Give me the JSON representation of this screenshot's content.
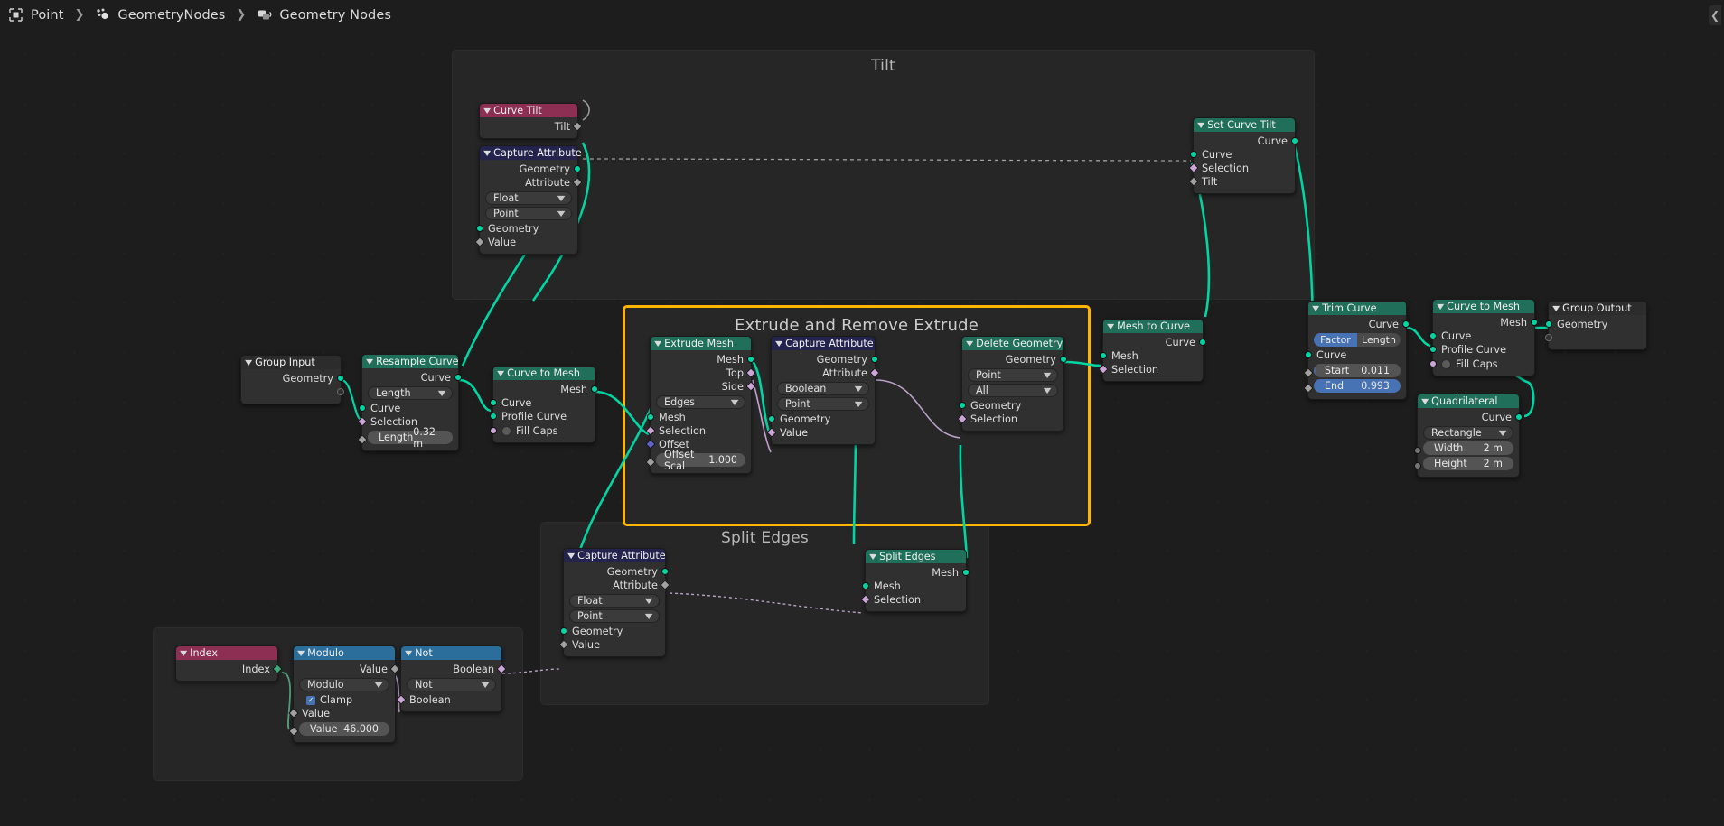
{
  "breadcrumb": {
    "items": [
      {
        "label": "Point",
        "icon": "object-icon"
      },
      {
        "label": "GeometryNodes",
        "icon": "modifier-icon"
      },
      {
        "label": "Geometry Nodes",
        "icon": "geometry-nodes-icon"
      }
    ],
    "collapse_arrow": "❮"
  },
  "frames": [
    {
      "id": "tilt",
      "title": "Tilt",
      "selected": false
    },
    {
      "id": "extrude",
      "title": "Extrude and Remove Extrude",
      "selected": true
    },
    {
      "id": "splitedges",
      "title": "Split Edges",
      "selected": false
    },
    {
      "id": "math",
      "title": "",
      "selected": false
    }
  ],
  "nodes": {
    "curve_tilt": {
      "title": "Curve Tilt",
      "outputs": [
        {
          "label": "Tilt"
        }
      ]
    },
    "capture_attribute_tilt": {
      "title": "Capture Attribute",
      "outputs": [
        {
          "label": "Geometry"
        },
        {
          "label": "Attribute"
        }
      ],
      "dropdowns": [
        {
          "value": "Float"
        },
        {
          "value": "Point"
        }
      ],
      "inputs": [
        {
          "label": "Geometry"
        },
        {
          "label": "Value"
        }
      ]
    },
    "set_curve_tilt": {
      "title": "Set Curve Tilt",
      "outputs": [
        {
          "label": "Curve"
        }
      ],
      "inputs": [
        {
          "label": "Curve"
        },
        {
          "label": "Selection"
        },
        {
          "label": "Tilt"
        }
      ]
    },
    "group_input": {
      "title": "Group Input",
      "outputs": [
        {
          "label": "Geometry"
        },
        {
          "label": ""
        }
      ]
    },
    "resample_curve": {
      "title": "Resample Curve",
      "outputs": [
        {
          "label": "Curve"
        }
      ],
      "dropdowns": [
        {
          "value": "Length"
        }
      ],
      "inputs": [
        {
          "label": "Curve"
        },
        {
          "label": "Selection"
        }
      ],
      "fields": [
        {
          "name": "Length",
          "value": "0.32 m"
        }
      ]
    },
    "curve_to_mesh_left": {
      "title": "Curve to Mesh",
      "outputs": [
        {
          "label": "Mesh"
        }
      ],
      "inputs": [
        {
          "label": "Curve"
        },
        {
          "label": "Profile Curve"
        },
        {
          "label": "Fill Caps"
        }
      ]
    },
    "extrude_mesh": {
      "title": "Extrude Mesh",
      "outputs": [
        {
          "label": "Mesh"
        },
        {
          "label": "Top"
        },
        {
          "label": "Side"
        }
      ],
      "dropdowns": [
        {
          "value": "Edges"
        }
      ],
      "inputs": [
        {
          "label": "Mesh"
        },
        {
          "label": "Selection"
        },
        {
          "label": "Offset"
        }
      ],
      "fields": [
        {
          "name": "Offset Scal",
          "value": "1.000"
        }
      ]
    },
    "capture_attribute_extrude": {
      "title": "Capture Attribute",
      "outputs": [
        {
          "label": "Geometry"
        },
        {
          "label": "Attribute"
        }
      ],
      "dropdowns": [
        {
          "value": "Boolean"
        },
        {
          "value": "Point"
        }
      ],
      "inputs": [
        {
          "label": "Geometry"
        },
        {
          "label": "Value"
        }
      ]
    },
    "delete_geometry": {
      "title": "Delete Geometry",
      "outputs": [
        {
          "label": "Geometry"
        }
      ],
      "dropdowns": [
        {
          "value": "Point"
        },
        {
          "value": "All"
        }
      ],
      "inputs": [
        {
          "label": "Geometry"
        },
        {
          "label": "Selection"
        }
      ]
    },
    "mesh_to_curve": {
      "title": "Mesh to Curve",
      "outputs": [
        {
          "label": "Curve"
        }
      ],
      "inputs": [
        {
          "label": "Mesh"
        },
        {
          "label": "Selection"
        }
      ]
    },
    "trim_curve": {
      "title": "Trim Curve",
      "outputs": [
        {
          "label": "Curve"
        }
      ],
      "toggle": {
        "left": "Factor",
        "right": "Length",
        "active": "Factor"
      },
      "inputs": [
        {
          "label": "Curve"
        }
      ],
      "fields": [
        {
          "name": "Start",
          "value": "0.011"
        },
        {
          "name": "End",
          "value": "0.993"
        }
      ]
    },
    "curve_to_mesh_right": {
      "title": "Curve to Mesh",
      "outputs": [
        {
          "label": "Mesh"
        }
      ],
      "inputs": [
        {
          "label": "Curve"
        },
        {
          "label": "Profile Curve"
        },
        {
          "label": "Fill Caps"
        }
      ]
    },
    "quadrilateral": {
      "title": "Quadrilateral",
      "outputs": [
        {
          "label": "Curve"
        }
      ],
      "dropdowns": [
        {
          "value": "Rectangle"
        }
      ],
      "fields": [
        {
          "name": "Width",
          "value": "2 m"
        },
        {
          "name": "Height",
          "value": "2 m"
        }
      ]
    },
    "group_output": {
      "title": "Group Output",
      "inputs": [
        {
          "label": "Geometry"
        },
        {
          "label": ""
        }
      ]
    },
    "capture_attribute_split": {
      "title": "Capture Attribute",
      "outputs": [
        {
          "label": "Geometry"
        },
        {
          "label": "Attribute"
        }
      ],
      "dropdowns": [
        {
          "value": "Float"
        },
        {
          "value": "Point"
        }
      ],
      "inputs": [
        {
          "label": "Geometry"
        },
        {
          "label": "Value"
        }
      ]
    },
    "split_edges": {
      "title": "Split Edges",
      "outputs": [
        {
          "label": "Mesh"
        }
      ],
      "inputs": [
        {
          "label": "Mesh"
        },
        {
          "label": "Selection"
        }
      ]
    },
    "index": {
      "title": "Index",
      "outputs": [
        {
          "label": "Index"
        }
      ]
    },
    "modulo": {
      "title": "Modulo",
      "outputs": [
        {
          "label": "Value"
        }
      ],
      "dropdowns": [
        {
          "value": "Modulo"
        }
      ],
      "checkbox": {
        "label": "Clamp",
        "checked": true,
        "mark": "✓"
      },
      "inputs": [
        {
          "label": "Value"
        }
      ],
      "fields": [
        {
          "name": "Value",
          "value": "46.000"
        }
      ]
    },
    "not": {
      "title": "Not",
      "outputs": [
        {
          "label": "Boolean"
        }
      ],
      "dropdowns": [
        {
          "value": "Not"
        }
      ],
      "inputs": [
        {
          "label": "Boolean"
        }
      ]
    }
  },
  "colors": {
    "geometry_header": "#1f6f5a",
    "attribute_header": "#23234d",
    "input_header": "#8c2f53",
    "converter_header": "#2b6d9b",
    "geometry_socket": "#00d6a3",
    "boolean_socket": "#cca6d6",
    "float_socket": "#a1a1a1",
    "vector_socket": "#6363c7",
    "selection_frame": "#ffb400",
    "slider_fill": "#4772b3",
    "canvas_bg": "#1d1d1d"
  }
}
